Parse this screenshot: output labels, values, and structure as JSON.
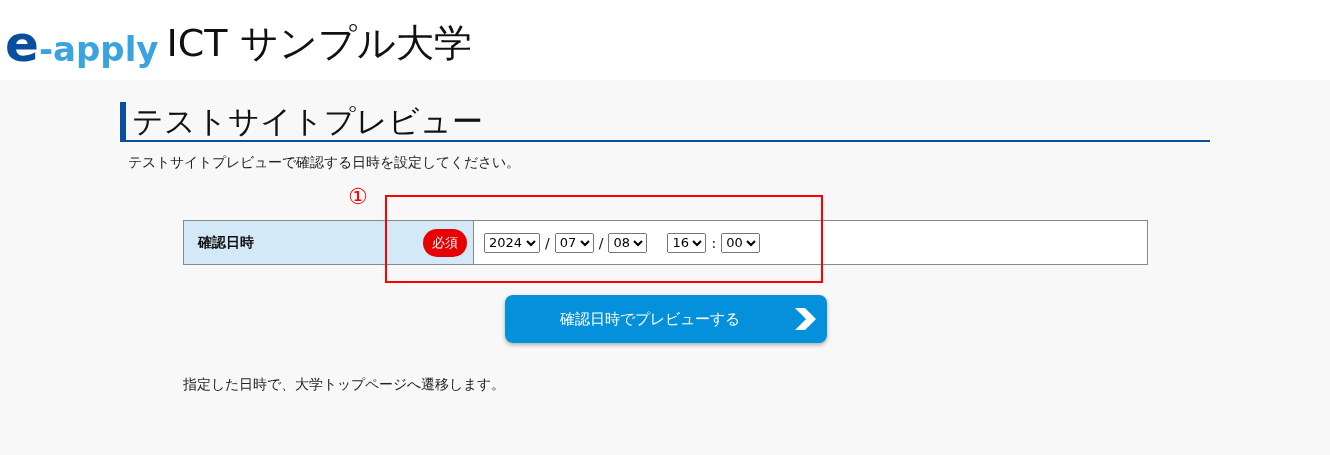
{
  "header": {
    "logo_e": "e",
    "logo_rest": "-apply",
    "site_name": "ICT サンプル大学"
  },
  "page_title": "テストサイトプレビュー",
  "description": "テストサイトプレビューで確認する日時を設定してください。",
  "form": {
    "label": "確認日時",
    "required_badge": "必須",
    "fields": [
      {
        "kind": "select",
        "value": "2024"
      },
      {
        "kind": "sep",
        "value": "/"
      },
      {
        "kind": "select",
        "value": "07"
      },
      {
        "kind": "sep",
        "value": "/"
      },
      {
        "kind": "select",
        "value": "08"
      },
      {
        "kind": "gap"
      },
      {
        "kind": "select",
        "value": "16"
      },
      {
        "kind": "sep",
        "value": ":"
      },
      {
        "kind": "select",
        "value": "00"
      }
    ]
  },
  "annotation": {
    "number": "①"
  },
  "submit_button": "確認日時でプレビューする",
  "note": "指定した日時で、大学トップページへ遷移します。"
}
